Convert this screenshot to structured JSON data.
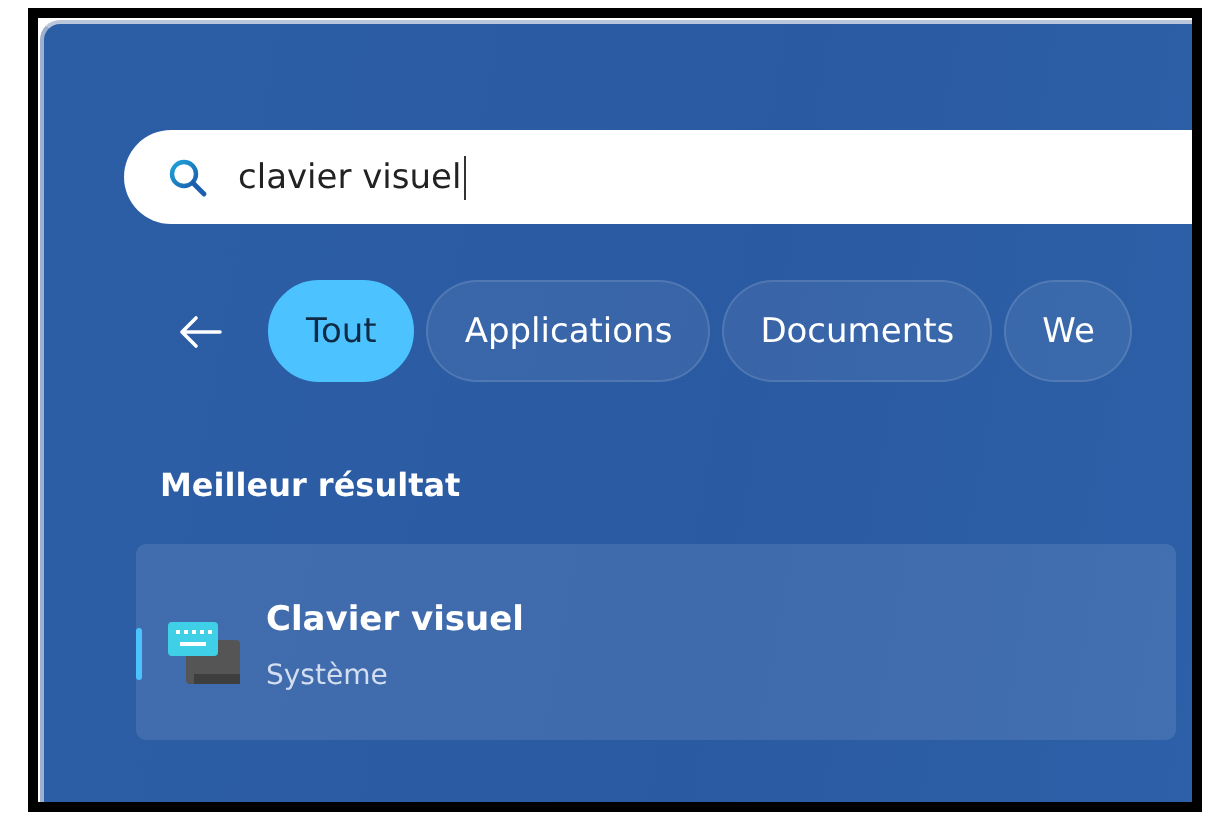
{
  "search": {
    "value": "clavier visuel"
  },
  "filters": [
    {
      "label": "Tout",
      "selected": true
    },
    {
      "label": "Applications",
      "selected": false
    },
    {
      "label": "Documents",
      "selected": false
    },
    {
      "label": "We",
      "selected": false
    }
  ],
  "best_match": {
    "heading": "Meilleur résultat",
    "results": [
      {
        "title": "Clavier visuel",
        "subtitle": "Système",
        "selected": true
      }
    ]
  }
}
